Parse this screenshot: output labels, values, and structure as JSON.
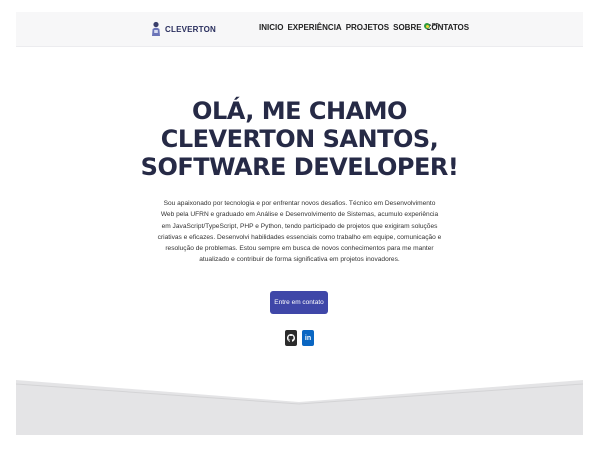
{
  "brand": {
    "name": "CLEVERTON"
  },
  "nav": {
    "items": [
      {
        "label": "INICIO"
      },
      {
        "label": "EXPERIÊNCIA"
      },
      {
        "label": "PROJETOS"
      },
      {
        "label": "SOBRE"
      },
      {
        "label": "CONTATOS"
      }
    ],
    "language": {
      "code": "PT"
    }
  },
  "hero": {
    "title_lines": [
      "OLÁ, ME CHAMO",
      "CLEVERTON SANTOS,",
      "SOFTWARE DEVELOPER!"
    ],
    "description": "Sou apaixonado por tecnologia e por enfrentar novos desafios. Técnico em Desenvolvimento Web pela UFRN e graduado em Análise e Desenvolvimento de Sistemas, acumulo experiência em JavaScript/TypeScript, PHP e Python, tendo participado de projetos que exigiram soluções criativas e eficazes. Desenvolvi habilidades essenciais como trabalho em equipe, comunicação e resolução de problemas. Estou sempre em busca de novos conhecimentos para me manter atualizado e contribuir de forma significativa em projetos inovadores.",
    "cta_label": "Entre em contato",
    "social": {
      "github_icon": "github-icon",
      "linkedin_label": "in"
    }
  },
  "colors": {
    "accent": "#3f47a8",
    "title": "#262a46",
    "github": "#2b2b2b",
    "linkedin": "#0a66c2"
  }
}
